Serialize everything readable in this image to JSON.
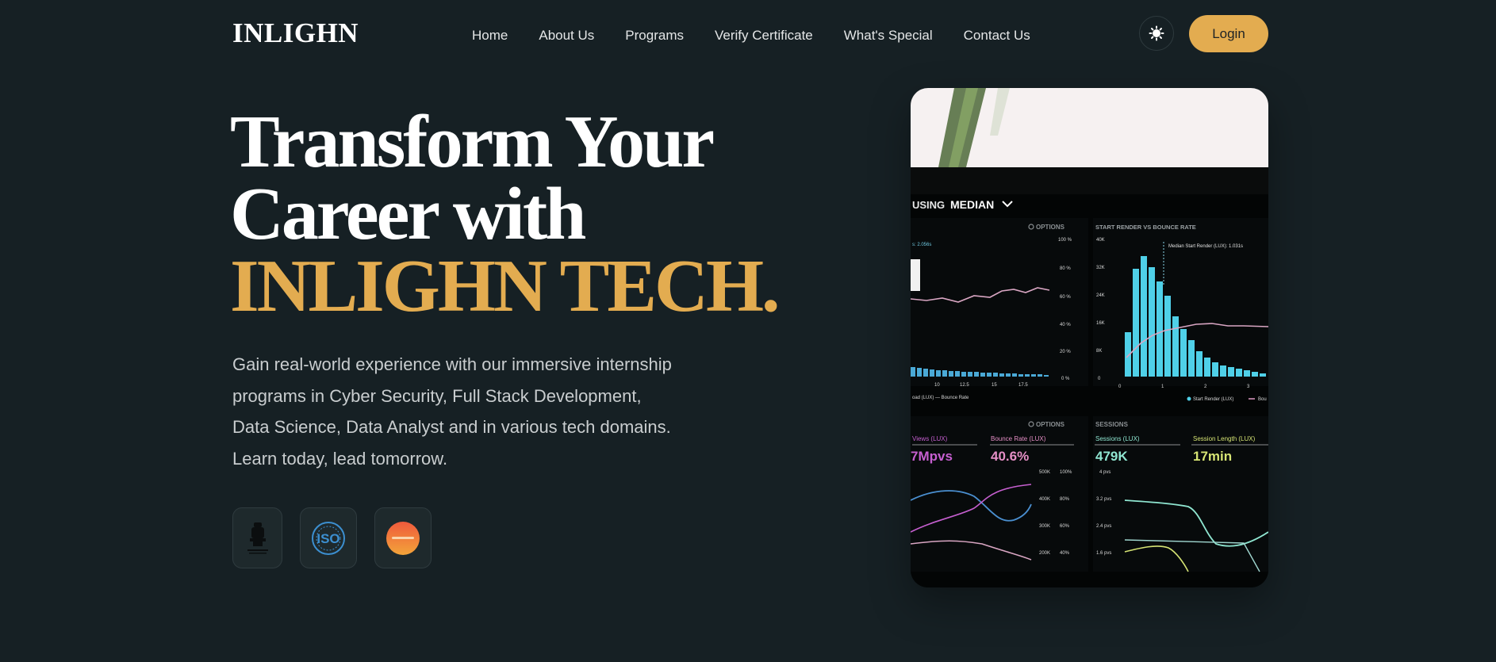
{
  "brand": {
    "logo_text": "INLIGHN",
    "accent_color": "#e3ac50",
    "background": "#162024"
  },
  "nav": {
    "items": [
      {
        "label": "Home"
      },
      {
        "label": "About Us"
      },
      {
        "label": "Programs"
      },
      {
        "label": "Verify Certificate"
      },
      {
        "label": "What's Special"
      },
      {
        "label": "Contact Us"
      }
    ],
    "theme_icon": "sun-icon",
    "login_label": "Login"
  },
  "hero": {
    "headline_line1": "Transform Your",
    "headline_line2": "Career with",
    "headline_accent": "INLIGHN TECH.",
    "description_lines": [
      "Gain real-world experience with our immersive internship",
      "programs in Cyber Security, Full Stack Development,",
      "Data Science, Data Analyst and in various tech domains.",
      "Learn today, lead tomorrow."
    ]
  },
  "badges": [
    {
      "name": "emblem-logo"
    },
    {
      "name": "iso-logo",
      "text": "ISO"
    },
    {
      "name": "certification-logo"
    }
  ],
  "dashboard_image": {
    "header_prefix": "USING",
    "header_metric": "MEDIAN",
    "options_label": "OPTIONS",
    "chart_title": "START RENDER VS BOUNCE RATE",
    "annotation": "Median Start Render (LUX): 1.031s",
    "left_annotation": "s: 2.056s",
    "left_y_ticks": [
      "100 %",
      "80 %",
      "60 %",
      "40 %",
      "20 %",
      "0 %"
    ],
    "right_y_ticks": [
      "40K",
      "32K",
      "24K",
      "16K",
      "8K",
      "0"
    ],
    "left_x_ticks": [
      "10",
      "12.5",
      "15",
      "17.5"
    ],
    "right_x_ticks": [
      "0",
      "1",
      "2",
      "3"
    ],
    "left_legend": "oad (LUX) — Bounce Rate",
    "right_legend_1": "Start Render (LUX)",
    "right_legend_2": "Bou",
    "sessions_title": "SESSIONS",
    "stats": [
      {
        "label": "Views (LUX)",
        "value": "7Mpvs",
        "color": "#c65fd0"
      },
      {
        "label": "Bounce Rate (LUX)",
        "value": "40.6%",
        "color": "#e58fc6"
      },
      {
        "label": "Sessions (LUX)",
        "value": "479K",
        "color": "#8fe6d1"
      },
      {
        "label": "Session Length (LUX)",
        "value": "17min",
        "color": "#d6e474"
      }
    ],
    "bottom_left_ticks_a": [
      "500K",
      "400K",
      "300K",
      "200K"
    ],
    "bottom_left_ticks_b": [
      "100%",
      "80%",
      "60%",
      "40%"
    ],
    "bottom_right_ticks": [
      "4 pvs",
      "3.2 pvs",
      "2.4 pvs",
      "1.6 pvs"
    ]
  }
}
